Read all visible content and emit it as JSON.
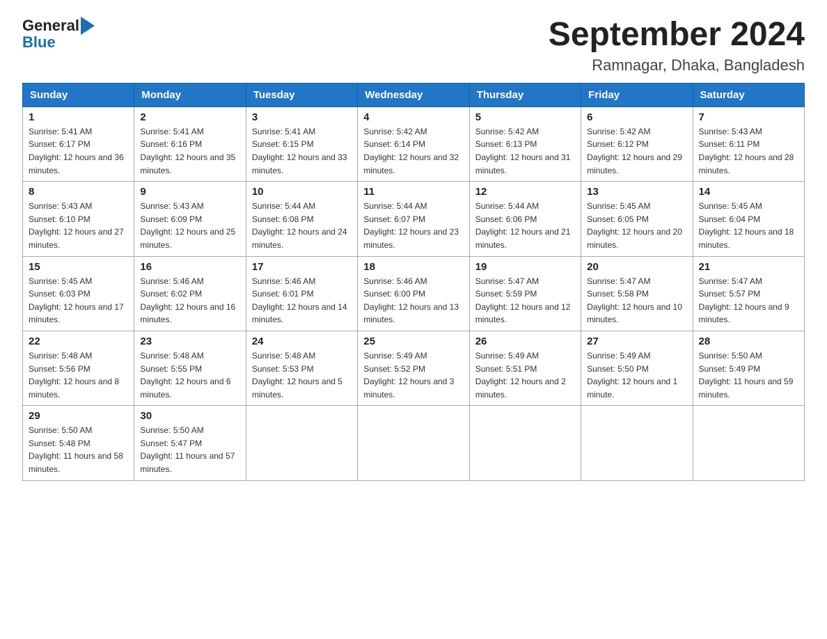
{
  "logo": {
    "text_general": "General",
    "text_blue": "Blue"
  },
  "title": "September 2024",
  "subtitle": "Ramnagar, Dhaka, Bangladesh",
  "headers": [
    "Sunday",
    "Monday",
    "Tuesday",
    "Wednesday",
    "Thursday",
    "Friday",
    "Saturday"
  ],
  "weeks": [
    [
      {
        "day": "1",
        "sunrise": "Sunrise: 5:41 AM",
        "sunset": "Sunset: 6:17 PM",
        "daylight": "Daylight: 12 hours and 36 minutes."
      },
      {
        "day": "2",
        "sunrise": "Sunrise: 5:41 AM",
        "sunset": "Sunset: 6:16 PM",
        "daylight": "Daylight: 12 hours and 35 minutes."
      },
      {
        "day": "3",
        "sunrise": "Sunrise: 5:41 AM",
        "sunset": "Sunset: 6:15 PM",
        "daylight": "Daylight: 12 hours and 33 minutes."
      },
      {
        "day": "4",
        "sunrise": "Sunrise: 5:42 AM",
        "sunset": "Sunset: 6:14 PM",
        "daylight": "Daylight: 12 hours and 32 minutes."
      },
      {
        "day": "5",
        "sunrise": "Sunrise: 5:42 AM",
        "sunset": "Sunset: 6:13 PM",
        "daylight": "Daylight: 12 hours and 31 minutes."
      },
      {
        "day": "6",
        "sunrise": "Sunrise: 5:42 AM",
        "sunset": "Sunset: 6:12 PM",
        "daylight": "Daylight: 12 hours and 29 minutes."
      },
      {
        "day": "7",
        "sunrise": "Sunrise: 5:43 AM",
        "sunset": "Sunset: 6:11 PM",
        "daylight": "Daylight: 12 hours and 28 minutes."
      }
    ],
    [
      {
        "day": "8",
        "sunrise": "Sunrise: 5:43 AM",
        "sunset": "Sunset: 6:10 PM",
        "daylight": "Daylight: 12 hours and 27 minutes."
      },
      {
        "day": "9",
        "sunrise": "Sunrise: 5:43 AM",
        "sunset": "Sunset: 6:09 PM",
        "daylight": "Daylight: 12 hours and 25 minutes."
      },
      {
        "day": "10",
        "sunrise": "Sunrise: 5:44 AM",
        "sunset": "Sunset: 6:08 PM",
        "daylight": "Daylight: 12 hours and 24 minutes."
      },
      {
        "day": "11",
        "sunrise": "Sunrise: 5:44 AM",
        "sunset": "Sunset: 6:07 PM",
        "daylight": "Daylight: 12 hours and 23 minutes."
      },
      {
        "day": "12",
        "sunrise": "Sunrise: 5:44 AM",
        "sunset": "Sunset: 6:06 PM",
        "daylight": "Daylight: 12 hours and 21 minutes."
      },
      {
        "day": "13",
        "sunrise": "Sunrise: 5:45 AM",
        "sunset": "Sunset: 6:05 PM",
        "daylight": "Daylight: 12 hours and 20 minutes."
      },
      {
        "day": "14",
        "sunrise": "Sunrise: 5:45 AM",
        "sunset": "Sunset: 6:04 PM",
        "daylight": "Daylight: 12 hours and 18 minutes."
      }
    ],
    [
      {
        "day": "15",
        "sunrise": "Sunrise: 5:45 AM",
        "sunset": "Sunset: 6:03 PM",
        "daylight": "Daylight: 12 hours and 17 minutes."
      },
      {
        "day": "16",
        "sunrise": "Sunrise: 5:46 AM",
        "sunset": "Sunset: 6:02 PM",
        "daylight": "Daylight: 12 hours and 16 minutes."
      },
      {
        "day": "17",
        "sunrise": "Sunrise: 5:46 AM",
        "sunset": "Sunset: 6:01 PM",
        "daylight": "Daylight: 12 hours and 14 minutes."
      },
      {
        "day": "18",
        "sunrise": "Sunrise: 5:46 AM",
        "sunset": "Sunset: 6:00 PM",
        "daylight": "Daylight: 12 hours and 13 minutes."
      },
      {
        "day": "19",
        "sunrise": "Sunrise: 5:47 AM",
        "sunset": "Sunset: 5:59 PM",
        "daylight": "Daylight: 12 hours and 12 minutes."
      },
      {
        "day": "20",
        "sunrise": "Sunrise: 5:47 AM",
        "sunset": "Sunset: 5:58 PM",
        "daylight": "Daylight: 12 hours and 10 minutes."
      },
      {
        "day": "21",
        "sunrise": "Sunrise: 5:47 AM",
        "sunset": "Sunset: 5:57 PM",
        "daylight": "Daylight: 12 hours and 9 minutes."
      }
    ],
    [
      {
        "day": "22",
        "sunrise": "Sunrise: 5:48 AM",
        "sunset": "Sunset: 5:56 PM",
        "daylight": "Daylight: 12 hours and 8 minutes."
      },
      {
        "day": "23",
        "sunrise": "Sunrise: 5:48 AM",
        "sunset": "Sunset: 5:55 PM",
        "daylight": "Daylight: 12 hours and 6 minutes."
      },
      {
        "day": "24",
        "sunrise": "Sunrise: 5:48 AM",
        "sunset": "Sunset: 5:53 PM",
        "daylight": "Daylight: 12 hours and 5 minutes."
      },
      {
        "day": "25",
        "sunrise": "Sunrise: 5:49 AM",
        "sunset": "Sunset: 5:52 PM",
        "daylight": "Daylight: 12 hours and 3 minutes."
      },
      {
        "day": "26",
        "sunrise": "Sunrise: 5:49 AM",
        "sunset": "Sunset: 5:51 PM",
        "daylight": "Daylight: 12 hours and 2 minutes."
      },
      {
        "day": "27",
        "sunrise": "Sunrise: 5:49 AM",
        "sunset": "Sunset: 5:50 PM",
        "daylight": "Daylight: 12 hours and 1 minute."
      },
      {
        "day": "28",
        "sunrise": "Sunrise: 5:50 AM",
        "sunset": "Sunset: 5:49 PM",
        "daylight": "Daylight: 11 hours and 59 minutes."
      }
    ],
    [
      {
        "day": "29",
        "sunrise": "Sunrise: 5:50 AM",
        "sunset": "Sunset: 5:48 PM",
        "daylight": "Daylight: 11 hours and 58 minutes."
      },
      {
        "day": "30",
        "sunrise": "Sunrise: 5:50 AM",
        "sunset": "Sunset: 5:47 PM",
        "daylight": "Daylight: 11 hours and 57 minutes."
      },
      null,
      null,
      null,
      null,
      null
    ]
  ]
}
